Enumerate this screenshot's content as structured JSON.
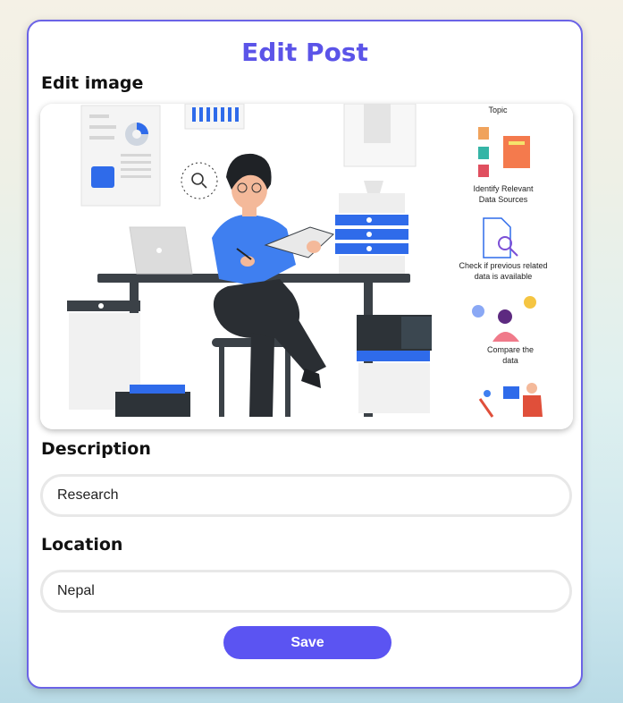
{
  "form": {
    "title": "Edit Post",
    "image_label": "Edit image",
    "description_label": "Description",
    "description_value": "Research",
    "location_label": "Location",
    "location_value": "Nepal",
    "save_label": "Save"
  },
  "illustration": {
    "step_topic": "Topic",
    "step_sources_1": "Identify Relevant",
    "step_sources_2": "Data Sources",
    "step_check_1": "Check if previous related",
    "step_check_2": "data is available",
    "step_compare_1": "Compare the",
    "step_compare_2": "data"
  },
  "colors": {
    "accent": "#5b54e8",
    "button": "#5b54f2",
    "card_border": "#6b63e6"
  }
}
